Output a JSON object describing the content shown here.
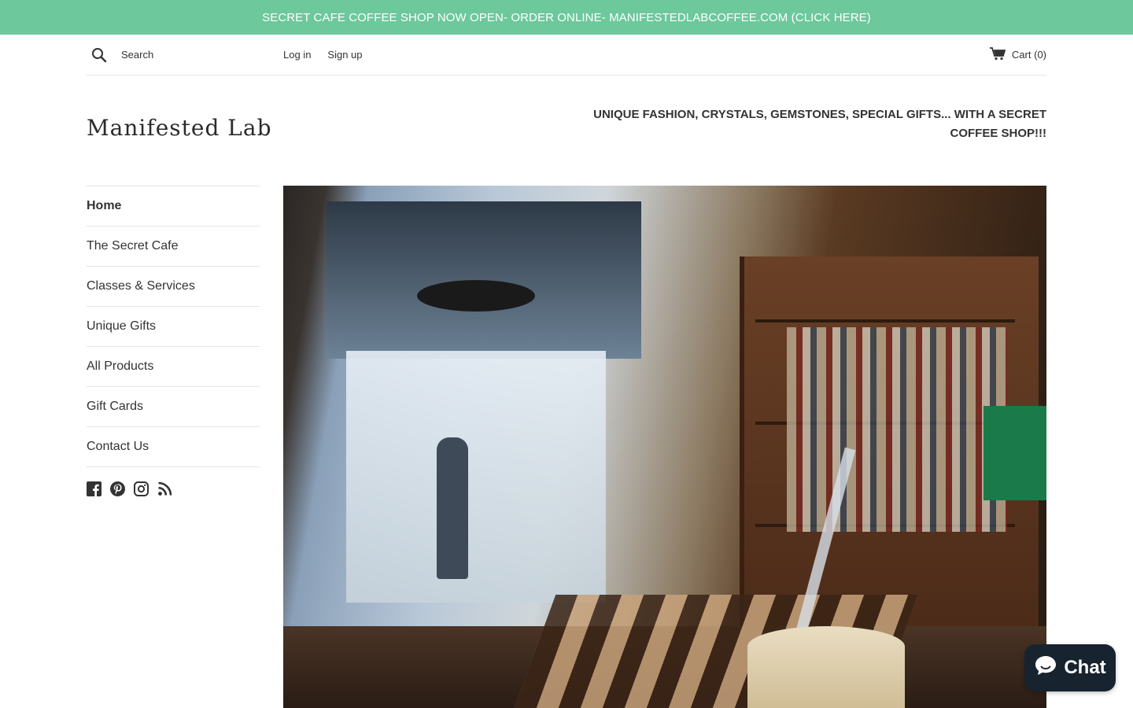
{
  "announcement": {
    "text": "SECRET CAFE COFFEE SHOP NOW OPEN- ORDER ONLINE- MANIFESTEDLABCOFFEE.COM (CLICK HERE)"
  },
  "topbar": {
    "search_placeholder": "Search",
    "login_label": "Log in",
    "signup_label": "Sign up",
    "cart_label": "Cart",
    "cart_count": "(0)"
  },
  "header": {
    "logo_text": "Manifested Lab",
    "tagline": "UNIQUE FASHION, CRYSTALS, GEMSTONES, SPECIAL GIFTS... WITH A SECRET COFFEE SHOP!!!"
  },
  "sidebar": {
    "items": [
      {
        "label": "Home",
        "active": true
      },
      {
        "label": "The Secret Cafe"
      },
      {
        "label": "Classes & Services"
      },
      {
        "label": "Unique Gifts"
      },
      {
        "label": "All Products"
      },
      {
        "label": "Gift Cards"
      },
      {
        "label": "Contact Us"
      }
    ],
    "social_icons": [
      "facebook-icon",
      "pinterest-icon",
      "instagram-icon",
      "rss-icon"
    ]
  },
  "chat": {
    "label": "Chat"
  },
  "colors": {
    "announcement_bg": "#6dc89b",
    "chat_bg": "#17232f",
    "text": "#333333",
    "divider": "#e4e4e4"
  }
}
